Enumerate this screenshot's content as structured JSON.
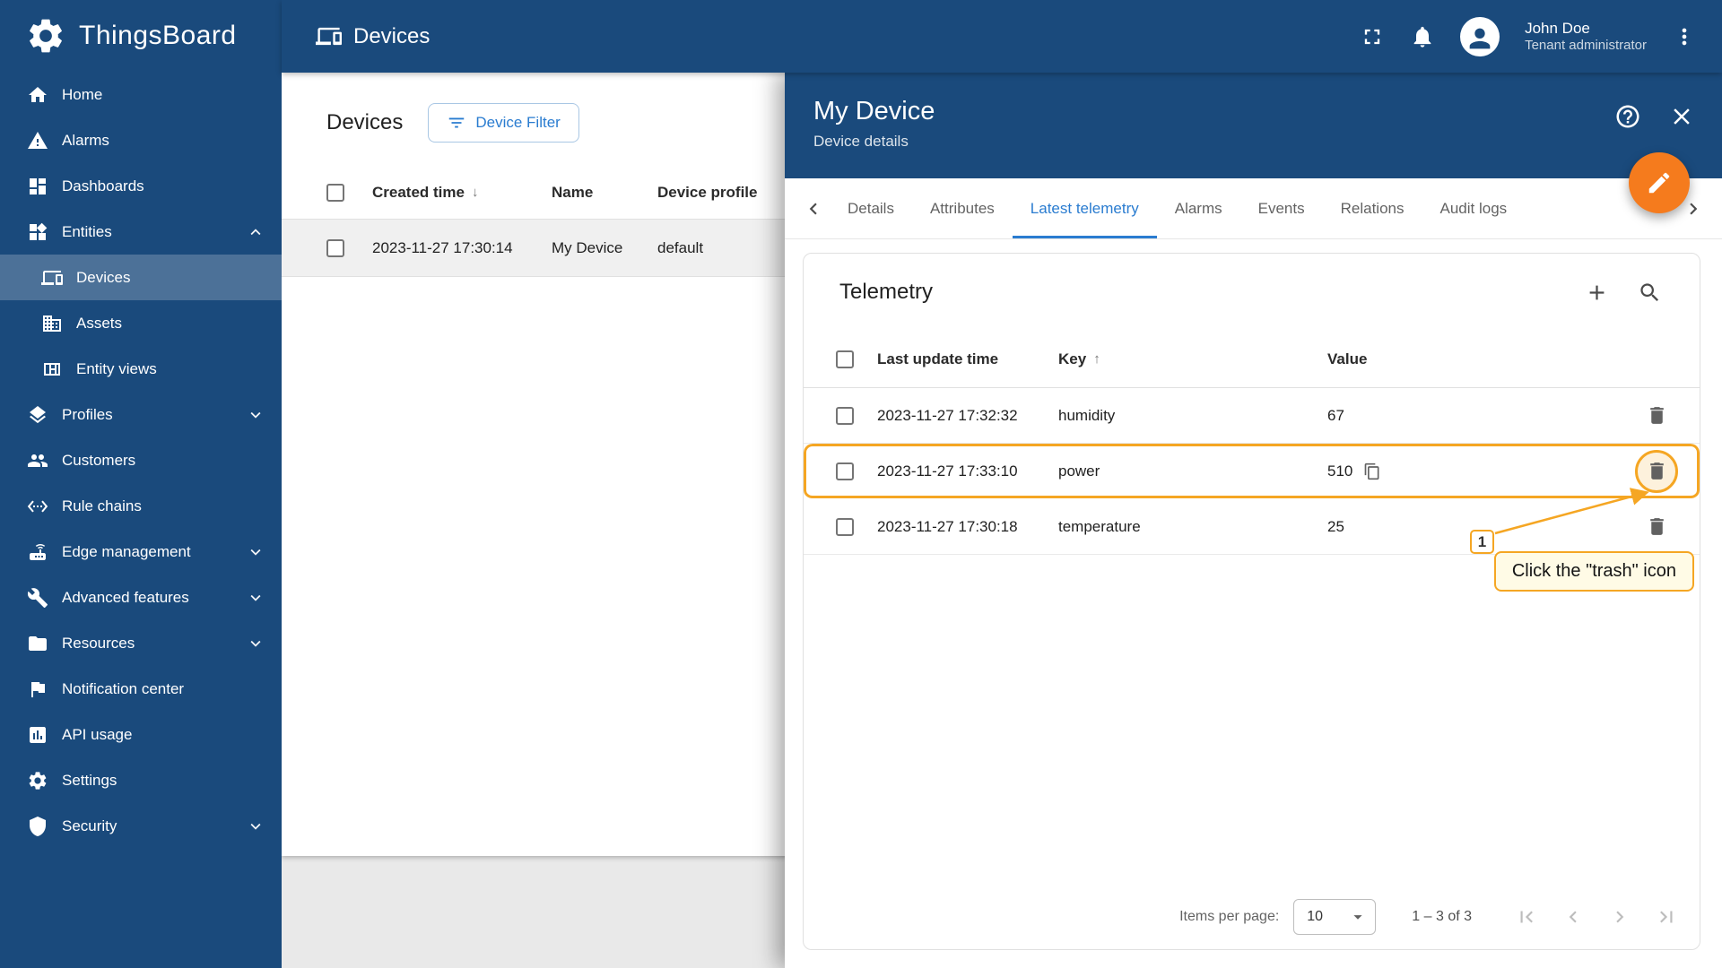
{
  "colors": {
    "navy": "#1a4a7c",
    "accent_blue": "#2a7cd0",
    "fab_orange": "#f57b1d",
    "highlight_amber": "#f5a623"
  },
  "sidebar": {
    "logo_text": "ThingsBoard",
    "items": [
      {
        "label": "Home",
        "icon": "home-icon"
      },
      {
        "label": "Alarms",
        "icon": "alarms-icon"
      },
      {
        "label": "Dashboards",
        "icon": "dashboards-icon"
      },
      {
        "label": "Entities",
        "icon": "entities-icon",
        "expanded": true
      },
      {
        "label": "Devices",
        "icon": "devices-icon",
        "active": true
      },
      {
        "label": "Assets",
        "icon": "assets-icon"
      },
      {
        "label": "Entity views",
        "icon": "entity-views-icon"
      },
      {
        "label": "Profiles",
        "icon": "profiles-icon",
        "collapsed": true
      },
      {
        "label": "Customers",
        "icon": "customers-icon"
      },
      {
        "label": "Rule chains",
        "icon": "rule-chains-icon"
      },
      {
        "label": "Edge management",
        "icon": "edge-management-icon",
        "collapsed": true
      },
      {
        "label": "Advanced features",
        "icon": "advanced-features-icon",
        "collapsed": true
      },
      {
        "label": "Resources",
        "icon": "resources-icon",
        "collapsed": true
      },
      {
        "label": "Notification center",
        "icon": "notification-center-icon"
      },
      {
        "label": "API usage",
        "icon": "api-usage-icon"
      },
      {
        "label": "Settings",
        "icon": "settings-icon"
      },
      {
        "label": "Security",
        "icon": "security-icon",
        "collapsed": true
      }
    ]
  },
  "topbar": {
    "title": "Devices",
    "user": {
      "name": "John Doe",
      "role": "Tenant administrator"
    }
  },
  "devices_page": {
    "title": "Devices",
    "filter_button": "Device Filter",
    "columns": [
      "Created time",
      "Name",
      "Device profile"
    ],
    "sort": {
      "column": "Created time",
      "direction": "desc"
    },
    "rows": [
      {
        "created": "2023-11-27 17:30:14",
        "name": "My Device",
        "profile": "default"
      }
    ]
  },
  "panel": {
    "title": "My Device",
    "subtitle": "Device details",
    "tabs": [
      "Details",
      "Attributes",
      "Latest telemetry",
      "Alarms",
      "Events",
      "Relations",
      "Audit logs"
    ],
    "active_tab": "Latest telemetry",
    "telemetry": {
      "title": "Telemetry",
      "columns": [
        "Last update time",
        "Key",
        "Value"
      ],
      "sort": {
        "column": "Key",
        "direction": "asc"
      },
      "rows": [
        {
          "time": "2023-11-27 17:32:32",
          "key": "humidity",
          "value": "67"
        },
        {
          "time": "2023-11-27 17:33:10",
          "key": "power",
          "value": "510",
          "highlighted": true,
          "copy": true
        },
        {
          "time": "2023-11-27 17:30:18",
          "key": "temperature",
          "value": "25"
        }
      ],
      "pagination": {
        "items_per_page_label": "Items per page:",
        "page_size": "10",
        "range": "1 – 3 of 3"
      }
    }
  },
  "annotation": {
    "step": "1",
    "text": "Click the \"trash\" icon"
  }
}
